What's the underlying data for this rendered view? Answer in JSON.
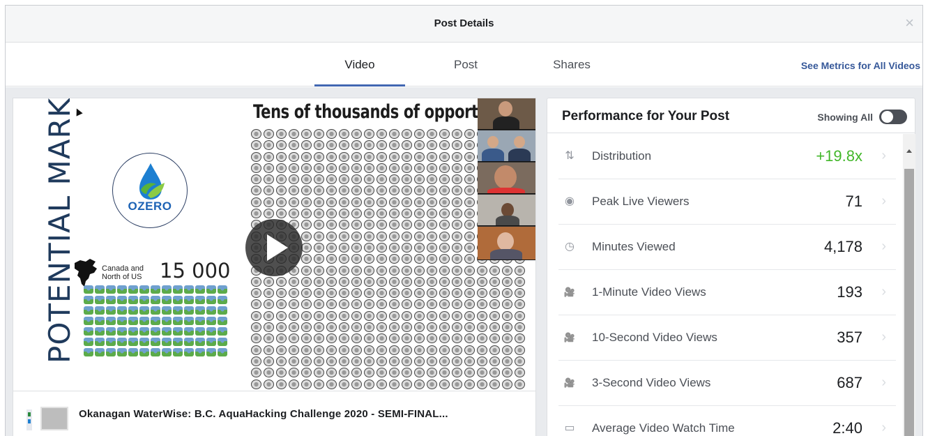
{
  "dialog": {
    "title": "Post Details",
    "close_label": "×"
  },
  "tabs": [
    {
      "label": "Video",
      "active": true
    },
    {
      "label": "Post",
      "active": false
    },
    {
      "label": "Shares",
      "active": false
    }
  ],
  "see_metrics_link": "See Metrics for All Videos",
  "video": {
    "slide": {
      "vertical_heading": "POTENTIAL MARKET",
      "logo_text": "OZERO",
      "region_label_line1": "Canada and",
      "region_label_line2": "North of US",
      "region_count": "15 000",
      "headline": "Tens of thousands of opportu"
    },
    "title": "Okanagan WaterWise: B.C. AquaHacking Challenge 2020 - SEMI-FINAL..."
  },
  "performance": {
    "title": "Performance for Your Post",
    "filter_label": "Showing All",
    "filter_on": false,
    "rows": [
      {
        "icon": "distribution-icon",
        "glyph": "⇅",
        "label": "Distribution",
        "value": "+19.8x",
        "highlight": true
      },
      {
        "icon": "eye-icon",
        "glyph": "◉",
        "label": "Peak Live Viewers",
        "value": "71",
        "highlight": false
      },
      {
        "icon": "clock-icon",
        "glyph": "◷",
        "label": "Minutes Viewed",
        "value": "4,178",
        "highlight": false
      },
      {
        "icon": "video-camera-icon",
        "glyph": "🎥",
        "label": "1-Minute Video Views",
        "value": "193",
        "highlight": false
      },
      {
        "icon": "video-camera-icon",
        "glyph": "🎥",
        "label": "10-Second Video Views",
        "value": "357",
        "highlight": false
      },
      {
        "icon": "video-camera-icon",
        "glyph": "🎥",
        "label": "3-Second Video Views",
        "value": "687",
        "highlight": false
      },
      {
        "icon": "video-outline-icon",
        "glyph": "▭",
        "label": "Average Video Watch Time",
        "value": "2:40",
        "highlight": false
      }
    ]
  },
  "colors": {
    "accent": "#4267b2",
    "link": "#365899",
    "positive": "#42b72a"
  }
}
